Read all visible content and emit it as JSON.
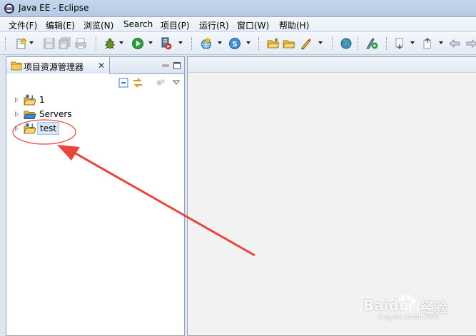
{
  "window": {
    "title": "Java EE  -  Eclipse"
  },
  "menu": [
    "文件(F)",
    "编辑(E)",
    "浏览(N)",
    "Search",
    "项目(P)",
    "运行(R)",
    "窗口(W)",
    "帮助(H)"
  ],
  "toolbar": {
    "icons": [
      "new-wizard-icon",
      "save-icon",
      "save-all-icon",
      "print-icon",
      "debug-icon",
      "run-icon",
      "run-server-icon",
      "new-web-project-icon",
      "new-class-icon",
      "open-project-icon",
      "open-folder-icon",
      "search-pen-icon",
      "globe-icon",
      "run-last-icon",
      "next-annotation-icon",
      "prev-annotation-icon",
      "back-icon",
      "forward-icon"
    ]
  },
  "explorer": {
    "tab_label": "项目资源管理器",
    "close_glyph": "✕",
    "items": [
      {
        "label": "1",
        "icon": "java-project-icon"
      },
      {
        "label": "Servers",
        "icon": "folder-open-icon"
      },
      {
        "label": "test",
        "icon": "web-project-icon",
        "selected": true
      }
    ]
  },
  "watermark": {
    "brand": "Baidu",
    "product": "经验",
    "domain": "jingyan.baidu.com"
  },
  "colors": {
    "annotation": "#e8453c",
    "selection": "#d9e8fb",
    "accent": "#3c78c8"
  }
}
